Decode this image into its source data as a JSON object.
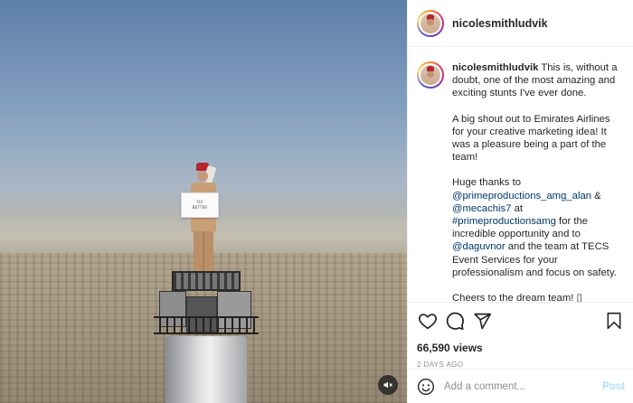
{
  "author": {
    "username": "nicolesmithludvik"
  },
  "media": {
    "sign_lines": [
      "FLY",
      "BETTER"
    ]
  },
  "caption": {
    "username": "nicolesmithludvik",
    "p1": "This is, without a doubt, one of the most amazing and exciting stunts I've ever done.",
    "p2": "A big shout out to Emirates Airlines for your creative marketing idea! It was a pleasure being a part of the team!",
    "p3_pre": "Huge thanks to",
    "m1": "@primeproductions_amg_alan",
    "p3_and1": " & ",
    "m2": "@mecachis7",
    "p3_at": " at",
    "m3": "#primeproductionsamg",
    "p3_mid": " for the incredible opportunity and to",
    "m4": "@daguvnor",
    "p3_end": " and the team at TECS Event Services for your professionalism and focus on safety.",
    "p4": "Cheers to the dream team! ▯"
  },
  "stats": {
    "views": "66,590 views",
    "time_ago": "2 days ago"
  },
  "comment_box": {
    "placeholder": "Add a comment...",
    "post_label": "Post"
  },
  "icons": {
    "like": "heart-icon",
    "comment": "comment-icon",
    "share": "share-icon",
    "save": "bookmark-icon",
    "emoji": "emoji-icon",
    "mute": "muted-speaker-icon"
  },
  "colors": {
    "mention": "#00376b",
    "post_button": "#b2dffc",
    "meta": "#8e8e8e"
  }
}
